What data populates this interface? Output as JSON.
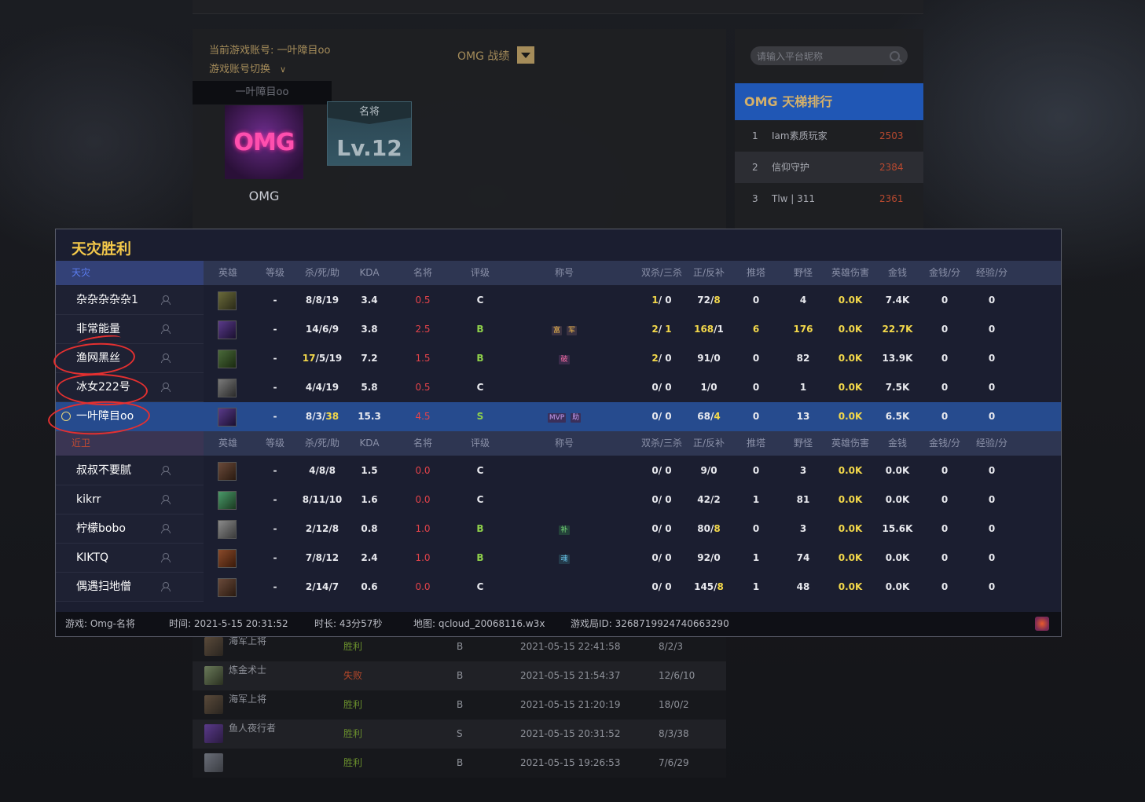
{
  "profile": {
    "current_account_label": "当前游戏账号: 一叶障目oo",
    "switch_label": "游戏账号切换",
    "dropdown_value": "一叶障目oo",
    "record_label": "OMG 战绩",
    "avatar_text": "OMG",
    "avatar_name": "OMG",
    "badge_title": "名将",
    "badge_level": "Lv.12"
  },
  "ladder": {
    "search_placeholder": "请输入平台昵称",
    "title": "OMG 天梯排行",
    "rows": [
      {
        "no": "1",
        "name": "Iam素质玩家",
        "score": "2503"
      },
      {
        "no": "2",
        "name": "信仰守护",
        "score": "2384"
      },
      {
        "no": "3",
        "name": "Tlw | 311",
        "score": "2361"
      }
    ]
  },
  "result": {
    "title": "天灾胜利",
    "team1": "天灾",
    "team2": "近卫",
    "headers": [
      "英雄",
      "等级",
      "杀/死/助",
      "KDA",
      "名将",
      "评级",
      "称号",
      "双杀/三杀",
      "正/反补",
      "推塔",
      "野怪",
      "英雄伤害",
      "金钱",
      "金钱/分",
      "经验/分"
    ],
    "team1_players": [
      {
        "name": "杂杂杂杂杂1",
        "level": "-",
        "k": "8",
        "d": "8",
        "a": "19",
        "kda": "3.4",
        "mj": "0.5",
        "grade": "C",
        "tags": [],
        "multi_a": "1",
        "multi_b": "0",
        "lh": "72",
        "dn": "8",
        "tower": "0",
        "jungle": "4",
        "dmg": "0.0K",
        "gold": "7.4K",
        "gpm": "0",
        "xpm": "0"
      },
      {
        "name": "非常能量",
        "level": "-",
        "k": "14",
        "d": "6",
        "a": "9",
        "kda": "3.8",
        "mj": "2.5",
        "grade": "B",
        "tags": [
          "富",
          "军"
        ],
        "multi_a": "2",
        "multi_b": "1",
        "lh": "168",
        "dn": "1",
        "tower": "6",
        "jungle": "176",
        "dmg": "0.0K",
        "gold": "22.7K",
        "gpm": "0",
        "xpm": "0"
      },
      {
        "name": "渔网黑丝",
        "level": "-",
        "k": "17",
        "d": "5",
        "a": "19",
        "kda": "7.2",
        "mj": "1.5",
        "grade": "B",
        "tags": [
          "破"
        ],
        "multi_a": "2",
        "multi_b": "0",
        "lh": "91",
        "dn": "0",
        "tower": "0",
        "jungle": "82",
        "dmg": "0.0K",
        "gold": "13.9K",
        "gpm": "0",
        "xpm": "0"
      },
      {
        "name": "冰女222号",
        "level": "-",
        "k": "4",
        "d": "4",
        "a": "19",
        "kda": "5.8",
        "mj": "0.5",
        "grade": "C",
        "tags": [],
        "multi_a": "0",
        "multi_b": "0",
        "lh": "1",
        "dn": "0",
        "tower": "0",
        "jungle": "1",
        "dmg": "0.0K",
        "gold": "7.5K",
        "gpm": "0",
        "xpm": "0"
      },
      {
        "name": "一叶障目oo",
        "level": "-",
        "k": "8",
        "d": "3",
        "a": "38",
        "kda": "15.3",
        "mj": "4.5",
        "grade": "S",
        "tags": [
          "MVP",
          "助"
        ],
        "multi_a": "0",
        "multi_b": "0",
        "lh": "68",
        "dn": "4",
        "tower": "0",
        "jungle": "13",
        "dmg": "0.0K",
        "gold": "6.5K",
        "gpm": "0",
        "xpm": "0"
      }
    ],
    "team2_players": [
      {
        "name": "叔叔不要腻",
        "level": "-",
        "k": "4",
        "d": "8",
        "a": "8",
        "kda": "1.5",
        "mj": "0.0",
        "grade": "C",
        "tags": [],
        "multi_a": "0",
        "multi_b": "0",
        "lh": "9",
        "dn": "0",
        "tower": "0",
        "jungle": "3",
        "dmg": "0.0K",
        "gold": "0.0K",
        "gpm": "0",
        "xpm": "0"
      },
      {
        "name": "kikrr",
        "level": "-",
        "k": "8",
        "d": "11",
        "a": "10",
        "kda": "1.6",
        "mj": "0.0",
        "grade": "C",
        "tags": [],
        "multi_a": "0",
        "multi_b": "0",
        "lh": "42",
        "dn": "2",
        "tower": "1",
        "jungle": "81",
        "dmg": "0.0K",
        "gold": "0.0K",
        "gpm": "0",
        "xpm": "0"
      },
      {
        "name": "柠檬bobo",
        "level": "-",
        "k": "2",
        "d": "12",
        "a": "8",
        "kda": "0.8",
        "mj": "1.0",
        "grade": "B",
        "tags": [
          "补"
        ],
        "multi_a": "0",
        "multi_b": "0",
        "lh": "80",
        "dn": "8",
        "tower": "0",
        "jungle": "3",
        "dmg": "0.0K",
        "gold": "15.6K",
        "gpm": "0",
        "xpm": "0"
      },
      {
        "name": "KIKTQ",
        "level": "-",
        "k": "7",
        "d": "8",
        "a": "12",
        "kda": "2.4",
        "mj": "1.0",
        "grade": "B",
        "tags": [
          "魂"
        ],
        "multi_a": "0",
        "multi_b": "0",
        "lh": "92",
        "dn": "0",
        "tower": "1",
        "jungle": "74",
        "dmg": "0.0K",
        "gold": "0.0K",
        "gpm": "0",
        "xpm": "0"
      },
      {
        "name": "偶遇扫地僧",
        "level": "-",
        "k": "2",
        "d": "14",
        "a": "7",
        "kda": "0.6",
        "mj": "0.0",
        "grade": "C",
        "tags": [],
        "multi_a": "0",
        "multi_b": "0",
        "lh": "145",
        "dn": "8",
        "tower": "1",
        "jungle": "48",
        "dmg": "0.0K",
        "gold": "0.0K",
        "gpm": "0",
        "xpm": "0"
      }
    ],
    "footer": {
      "game": "游戏: Omg-名将",
      "time": "时间: 2021-5-15 20:31:52",
      "duration": "时长: 43分57秒",
      "map": "地图: qcloud_20068116.w3x",
      "game_id": "游戏局ID: 3268719924740663290"
    }
  },
  "history": [
    {
      "hero": "海军上将",
      "result": "胜利",
      "rating": "B",
      "date": "2021-05-15 22:41:58",
      "kda": "8/2/3"
    },
    {
      "hero": "炼金术士",
      "result": "失败",
      "rating": "B",
      "date": "2021-05-15 21:54:37",
      "kda": "12/6/10"
    },
    {
      "hero": "海军上将",
      "result": "胜利",
      "rating": "B",
      "date": "2021-05-15 21:20:19",
      "kda": "18/0/2"
    },
    {
      "hero": "鱼人夜行者",
      "result": "胜利",
      "rating": "S",
      "date": "2021-05-15 20:31:52",
      "kda": "8/3/38"
    },
    {
      "hero": "",
      "result": "胜利",
      "rating": "B",
      "date": "2021-05-15 19:26:53",
      "kda": "7/6/29"
    }
  ],
  "colors": {
    "accent_gold": "#f3c84a",
    "win": "#6a8f2d",
    "lose": "#b5482a",
    "ladder_header": "#2057b5",
    "highlight_row": "#264b8e"
  }
}
